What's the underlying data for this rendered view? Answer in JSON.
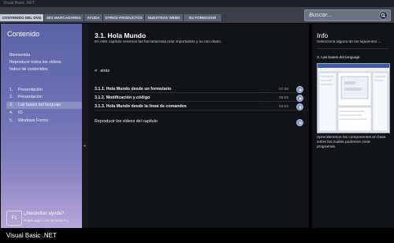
{
  "window": {
    "title": "Visual Basic .NET"
  },
  "nav": {
    "tabs": [
      {
        "label": "CONTENIDO DEL DVD",
        "active": true
      },
      {
        "label": "MIS MARCADORES",
        "active": false
      },
      {
        "label": "AYUDA",
        "active": false
      },
      {
        "label": "OTROS PRODUCTOS",
        "active": false
      },
      {
        "label": "NUESTRAS WEBS",
        "active": false
      },
      {
        "label": "SU FORMADOR",
        "active": false
      }
    ],
    "search_placeholder": "Buscar..."
  },
  "sidebar": {
    "title": "Contenido",
    "links": [
      "Bienvenida",
      "Reproducir todos los vídeos",
      "Índice de contenidos"
    ],
    "chapters": [
      {
        "num": "1.",
        "label": "Presentación"
      },
      {
        "num": "2.",
        "label": "Presentación"
      },
      {
        "num": "3.",
        "label": "Las bases del lenguaje",
        "selected": true
      },
      {
        "num": "4.",
        "label": "IO"
      },
      {
        "num": "5.",
        "label": "Windows Forms"
      }
    ],
    "help": {
      "key": "F1",
      "title": "¿Necesitas ayuda?",
      "subtitle": "Pulsa aquí o en la tecla F1."
    }
  },
  "main": {
    "title": "3.1. Hola Mundo",
    "description": "En este capítulo veremos las herramientas más importantes y su uso diario.",
    "back_label": "atrás",
    "videos": [
      {
        "title": "3.1.1. Hola Mundo desde un formulario",
        "duration": "07:38"
      },
      {
        "title": "3.1.2. Modificación y código",
        "duration": "06:05"
      },
      {
        "title": "3.1.3. Hola Mundo desde la línea de comandos",
        "duration": "04:53"
      }
    ],
    "play_chapter_label": "Reproducir los vídeos del capítulo"
  },
  "info": {
    "title": "Info",
    "subtitle": "Selecciona alguna de las siguientes ...",
    "caption": "3. Las bases del lenguaje",
    "text": "Aprenderemos los componentes en base sobre los cuales podemos crear programas."
  },
  "footer": {
    "title": "Visual Basic .NET"
  },
  "colors": {
    "accent": "#7f93c8",
    "sidebar_top": "#5c63a4",
    "sidebar_bottom": "#b5a7d8"
  }
}
